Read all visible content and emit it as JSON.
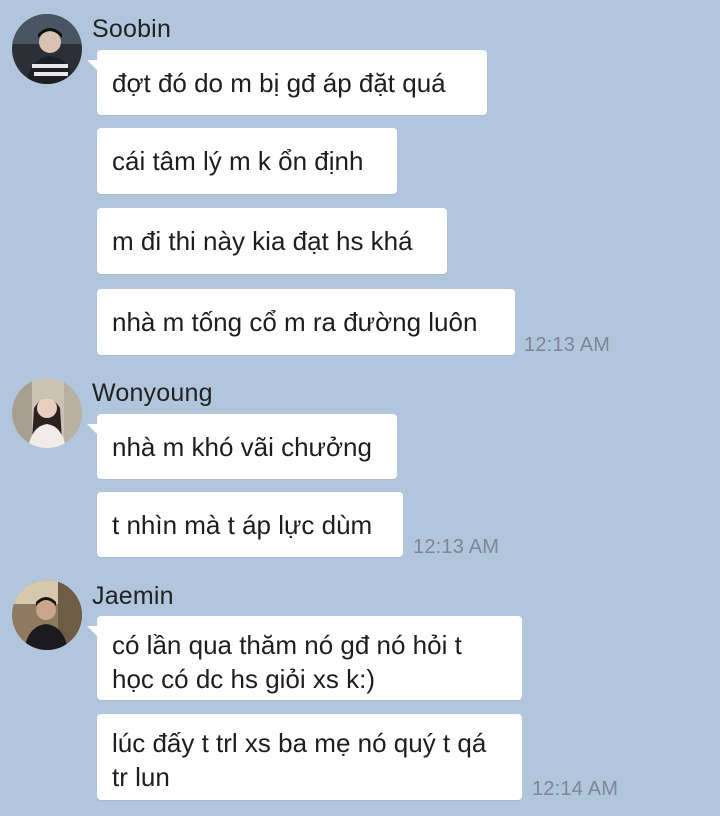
{
  "colors": {
    "background": "#b1c6dd",
    "bubble": "#ffffff",
    "timestamp": "#7a8795"
  },
  "groups": [
    {
      "sender": "Soobin",
      "avatar_icon": "user-avatar-icon",
      "messages": [
        "đợt đó do m bị gđ áp đặt quá",
        "cái tâm lý m k ổn định",
        "m đi thi này kia đạt hs khá",
        "nhà m tống cổ m ra đường luôn"
      ],
      "time": "12:13 AM"
    },
    {
      "sender": "Wonyoung",
      "avatar_icon": "user-avatar-icon",
      "messages": [
        "nhà m khó vãi chưởng",
        "t nhìn mà t áp lực dùm"
      ],
      "time": "12:13 AM"
    },
    {
      "sender": "Jaemin",
      "avatar_icon": "user-avatar-icon",
      "messages": [
        "có lần qua thăm nó gđ nó hỏi t học có dc hs giỏi xs k:)",
        "lúc đấy t trl xs ba mẹ nó quý t qá tr lun"
      ],
      "time": "12:14 AM"
    }
  ]
}
